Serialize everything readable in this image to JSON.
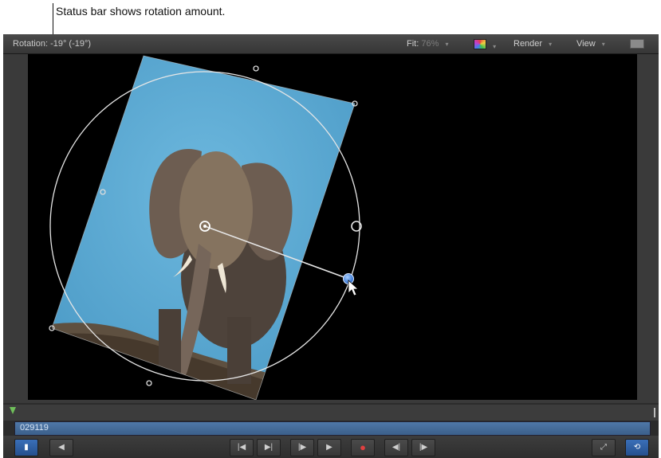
{
  "callout": {
    "text": "Status bar shows rotation amount."
  },
  "statusbar": {
    "readout": "Rotation: -19° (-19°)",
    "fit_label": "Fit:",
    "fit_value": "76%",
    "render_label": "Render",
    "view_label": "View"
  },
  "timeline": {
    "timecode": "029119"
  },
  "icons": {
    "caret": "▾",
    "play": "▶",
    "go_start": "|◀",
    "go_end": "▶|",
    "record": "●",
    "prev_frame": "◀|",
    "next_frame": "|▶",
    "step_back": "◀",
    "fullscreen": "⤢",
    "loop": "⟲",
    "audio": "◀"
  },
  "canvas": {
    "background": "#000000",
    "photo_sky": "#5aa9d3",
    "handle_color": "#4a8ee8"
  }
}
